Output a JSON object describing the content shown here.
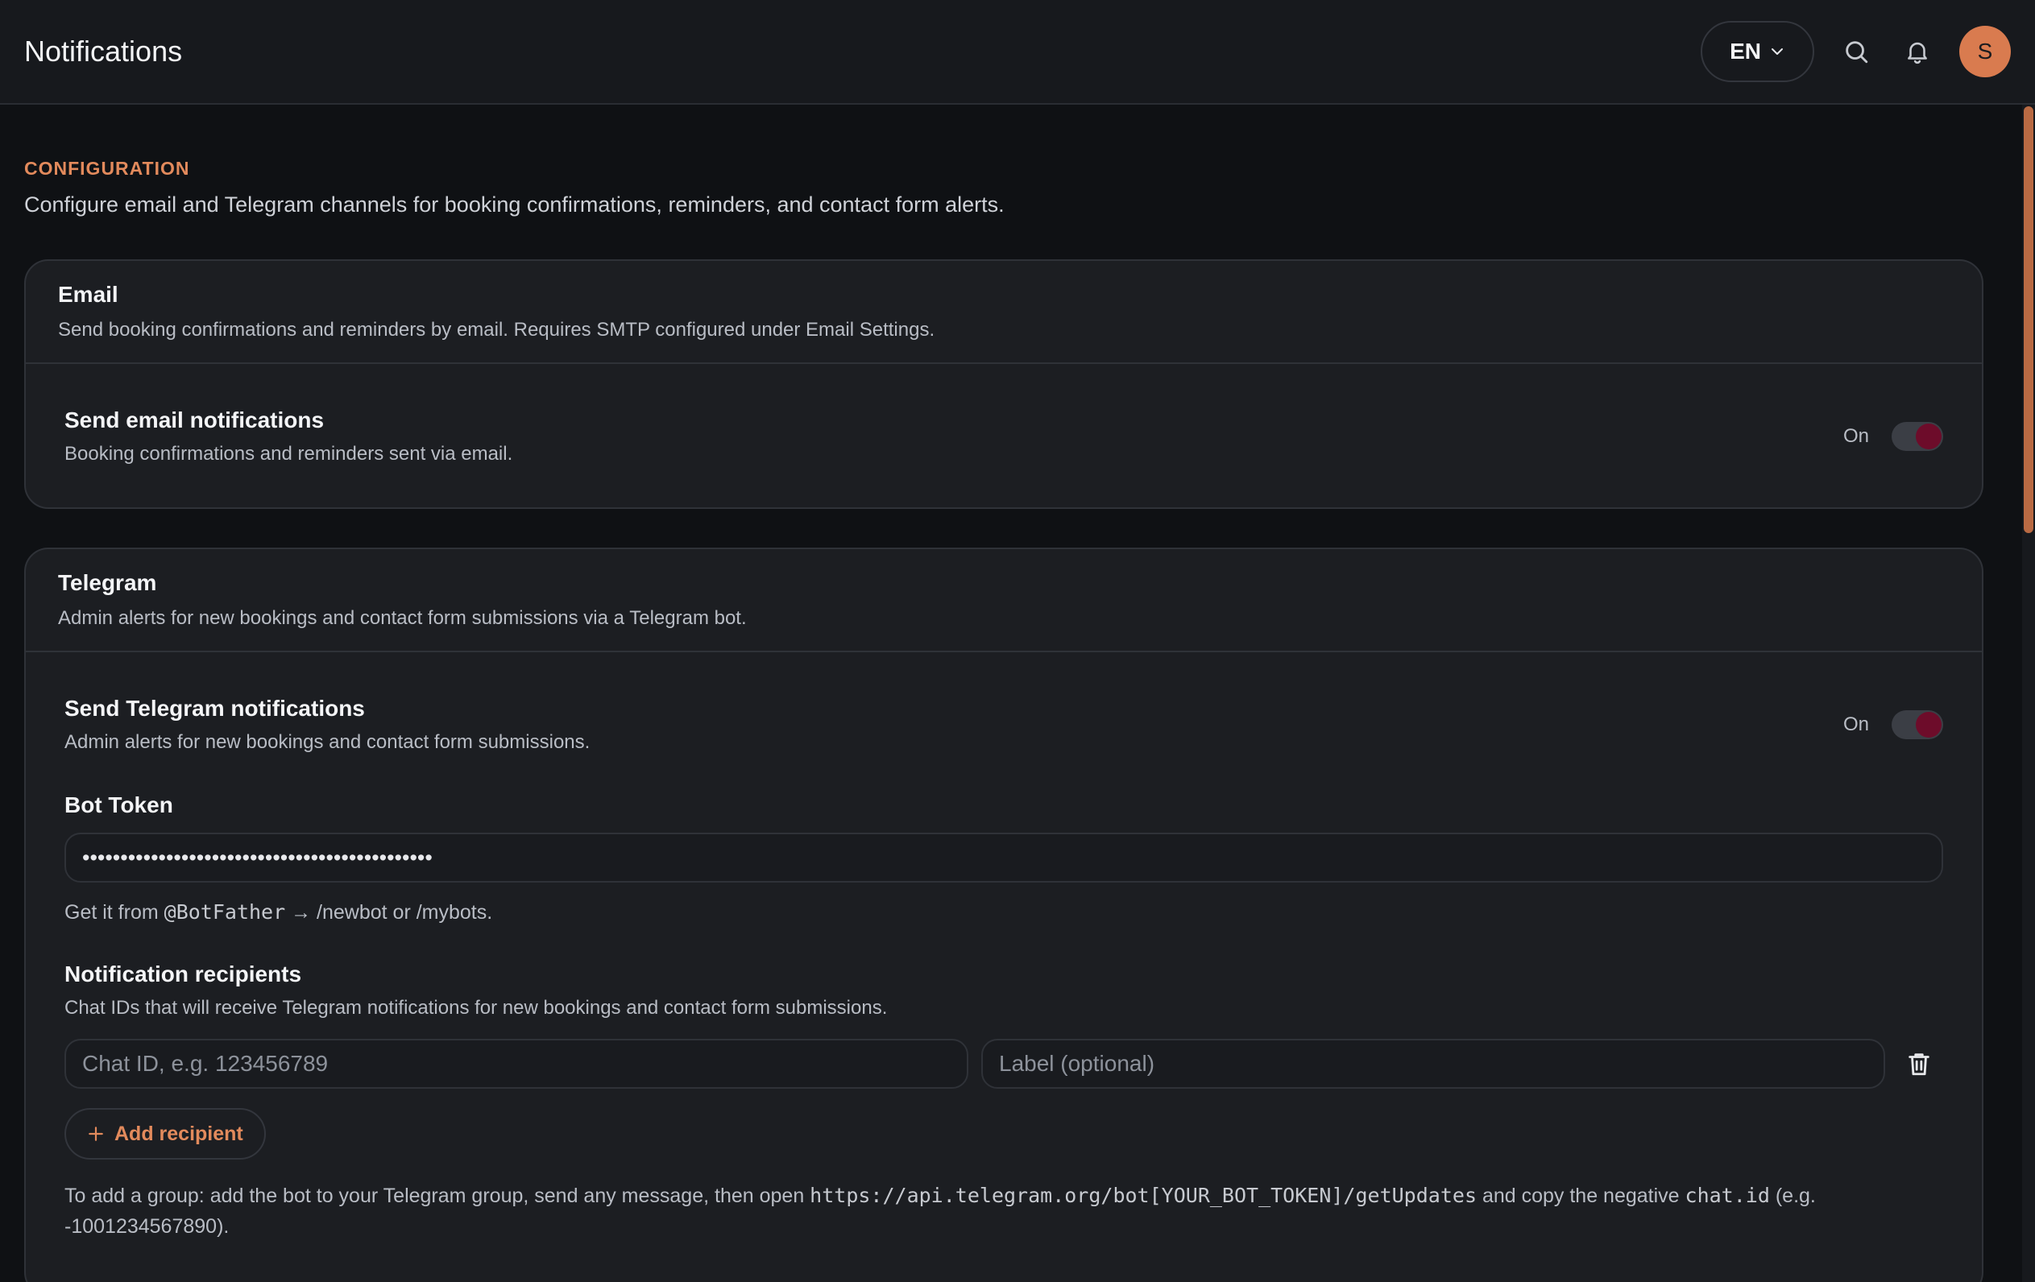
{
  "header": {
    "title": "Notifications",
    "language": "EN",
    "avatar_initial": "S"
  },
  "intro": {
    "eyebrow": "CONFIGURATION",
    "description": "Configure email and Telegram channels for booking confirmations, reminders, and contact form alerts."
  },
  "email_card": {
    "title": "Email",
    "subtitle": "Send booking confirmations and reminders by email. Requires SMTP configured under Email Settings.",
    "setting": {
      "title": "Send email notifications",
      "subtitle": "Booking confirmations and reminders sent via email.",
      "state_label": "On",
      "enabled": true
    }
  },
  "telegram_card": {
    "title": "Telegram",
    "subtitle": "Admin alerts for new bookings and contact form submissions via a Telegram bot.",
    "setting": {
      "title": "Send Telegram notifications",
      "subtitle": "Admin alerts for new bookings and contact form submissions.",
      "state_label": "On",
      "enabled": true
    },
    "bot_token": {
      "label": "Bot Token",
      "value": "••••••••••••••••••••••••••••••••••••••••••••••",
      "help_prefix": "Get it from ",
      "help_code": "@BotFather",
      "help_suffix": " → /newbot or /mybots."
    },
    "recipients": {
      "title": "Notification recipients",
      "subtitle": "Chat IDs that will receive Telegram notifications for new bookings and contact form submissions.",
      "chat_id_placeholder": "Chat ID, e.g. 123456789",
      "label_placeholder": "Label (optional)",
      "add_label": "Add recipient"
    },
    "group_help": {
      "prefix": "To add a group: add the bot to your Telegram group, send any message, then open ",
      "url_code": "https://api.telegram.org/bot[YOUR_BOT_TOKEN]/getUpdates",
      "middle": " and copy the negative ",
      "chat_code": "chat.id",
      "suffix": " (e.g. -1001234567890)."
    }
  },
  "colors": {
    "accent": "#e28a5c",
    "toggle_on": "#6d0c2a",
    "avatar": "#d97b4f"
  }
}
